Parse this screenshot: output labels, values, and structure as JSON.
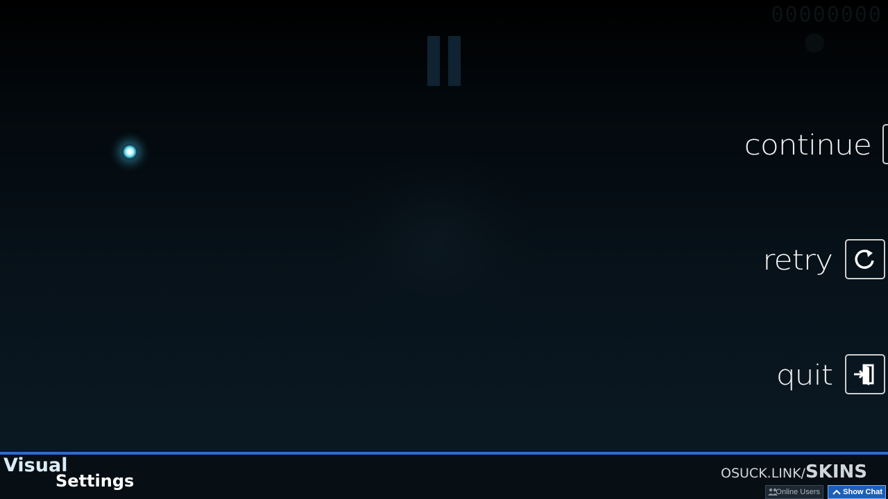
{
  "pause_menu": {
    "items": [
      {
        "id": "continue",
        "label": "continue",
        "icon": "play-icon"
      },
      {
        "id": "retry",
        "label": "retry",
        "icon": "retry-icon"
      },
      {
        "id": "quit",
        "label": "quit",
        "icon": "exit-door-icon"
      }
    ]
  },
  "hud": {
    "score": "00000000"
  },
  "overlay": {
    "visual_settings_line1": "Visual",
    "visual_settings_line2": "Settings",
    "watermark_small": "OSUCK.LINK/",
    "watermark_big": "SKINS",
    "online_users_label": "Online Users",
    "show_chat_label": "Show Chat"
  },
  "colors": {
    "accent": "#2a6fc9",
    "cursor": "#5fd6ec",
    "menu_text": "#f4f4f4"
  }
}
